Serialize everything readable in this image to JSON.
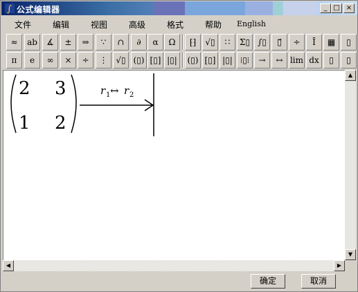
{
  "window": {
    "title": "公式编辑器"
  },
  "title_buttons": {
    "minimize": "_",
    "maximize": "□",
    "close": "×"
  },
  "menu": [
    "文件",
    "编辑",
    "视图",
    "高级",
    "格式",
    "帮助",
    "English"
  ],
  "toolbar1": [
    "≈",
    "ab",
    "∡",
    "±",
    "⇒",
    "∵",
    "∩",
    "∂",
    "α",
    "Ω",
    "⁅⁆",
    "√▯",
    "∷",
    "Σ▯",
    "∫▯",
    "▯⃗",
    "÷",
    "Ī",
    "▦",
    "▯"
  ],
  "toolbar2": [
    "π",
    "e",
    "∞",
    "×",
    "÷",
    "⋮",
    "√▯",
    "(▯)",
    "[▯]",
    "|▯|",
    "(▯)",
    "[▯]",
    "|▯|",
    "⁞▯⁞",
    "→",
    "↔",
    "lim",
    "dx",
    "▯",
    "▯"
  ],
  "equation": {
    "matrix": [
      [
        "2",
        "3"
      ],
      [
        "1",
        "2"
      ]
    ],
    "arrow_label_left": "r",
    "arrow_label_left_sub": "1",
    "arrow_label_mid": "↔",
    "arrow_label_right": "r",
    "arrow_label_right_sub": "2"
  },
  "buttons": {
    "ok": "确定",
    "cancel": "取消"
  },
  "colors": {
    "title_dark": "#0a246a",
    "title_light": "#a6caf0",
    "face": "#d4d0c8"
  }
}
